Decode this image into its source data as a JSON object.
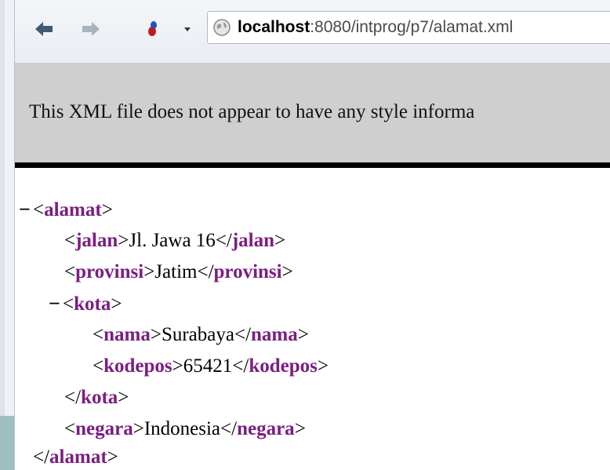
{
  "toolbar": {
    "back_icon": "back-arrow-icon",
    "forward_icon": "forward-arrow-icon",
    "addon_icon": "addon-icon",
    "dropdown_icon": "chevron-down-icon",
    "globe_icon": "globe-icon",
    "url_host": "localhost",
    "url_rest": ":8080/intprog/p7/alamat.xml"
  },
  "notice": {
    "text": "This XML file does not appear to have any style informa"
  },
  "xml": {
    "collapse_symbol": "−",
    "alamat": "alamat",
    "jalan": "jalan",
    "jalan_value": "Jl. Jawa 16",
    "provinsi": "provinsi",
    "provinsi_value": "Jatim",
    "kota": "kota",
    "nama": "nama",
    "nama_value": "Surabaya",
    "kodepos": "kodepos",
    "kodepos_value": "65421",
    "negara": "negara",
    "negara_value": "Indonesia"
  },
  "colors": {
    "tag": "#7a1e82",
    "notice_bg": "#cfcfcf"
  }
}
